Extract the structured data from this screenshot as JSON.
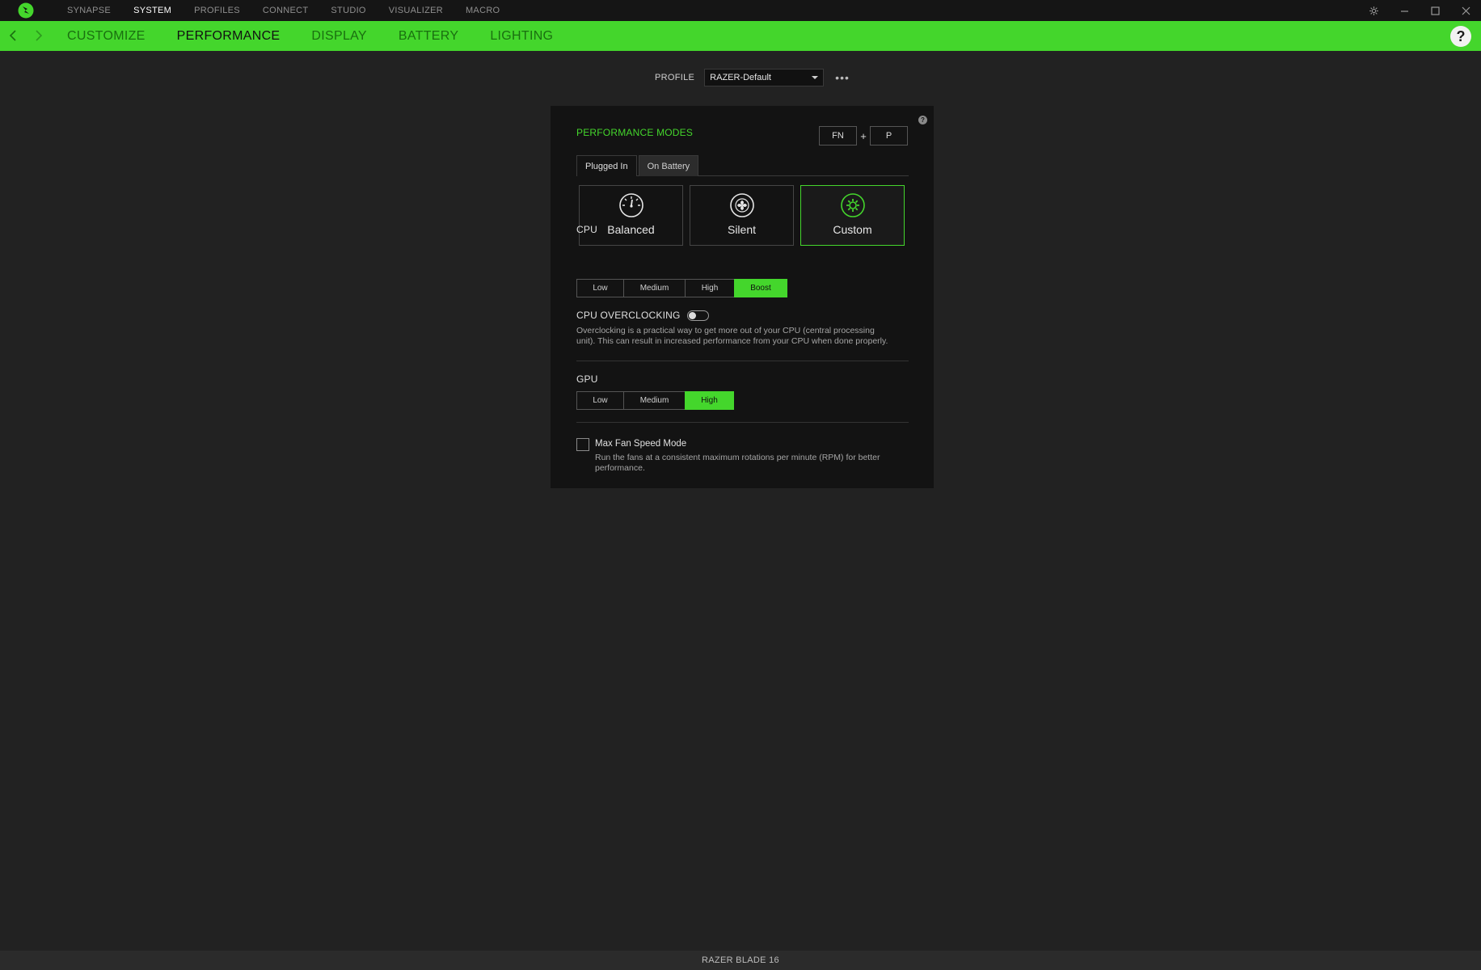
{
  "top_nav": {
    "items": [
      {
        "label": "SYNAPSE",
        "active": false
      },
      {
        "label": "SYSTEM",
        "active": true
      },
      {
        "label": "PROFILES",
        "active": false
      },
      {
        "label": "CONNECT",
        "active": false
      },
      {
        "label": "STUDIO",
        "active": false
      },
      {
        "label": "VISUALIZER",
        "active": false
      },
      {
        "label": "MACRO",
        "active": false
      }
    ]
  },
  "sub_nav": {
    "tabs": [
      {
        "label": "CUSTOMIZE",
        "active": false
      },
      {
        "label": "PERFORMANCE",
        "active": true
      },
      {
        "label": "DISPLAY",
        "active": false
      },
      {
        "label": "BATTERY",
        "active": false
      },
      {
        "label": "LIGHTING",
        "active": false
      }
    ],
    "help_icon": "?"
  },
  "profile": {
    "label": "PROFILE",
    "selected": "RAZER-Default",
    "more": "•••"
  },
  "panel": {
    "help_icon": "?",
    "title": "PERFORMANCE MODES",
    "shortcut": {
      "key1": "FN",
      "plus": "+",
      "key2": "P"
    },
    "power_tabs": [
      {
        "label": "Plugged In",
        "active": true
      },
      {
        "label": "On Battery",
        "active": false
      }
    ],
    "modes": [
      {
        "label": "Balanced",
        "icon": "gauge-icon",
        "selected": false
      },
      {
        "label": "Silent",
        "icon": "fan-icon",
        "selected": false
      },
      {
        "label": "Custom",
        "icon": "gear-icon",
        "selected": true
      }
    ],
    "cpu": {
      "label": "CPU",
      "options": [
        "Low",
        "Medium",
        "High",
        "Boost"
      ],
      "selected": "Boost"
    },
    "overclocking": {
      "label": "CPU OVERCLOCKING",
      "enabled": false,
      "desc_line1": "Overclocking is a practical way to get more out of your CPU (central processing",
      "desc_line2": "unit). This can result in increased performance from your CPU when done properly."
    },
    "gpu": {
      "label": "GPU",
      "options": [
        "Low",
        "Medium",
        "High"
      ],
      "selected": "High"
    },
    "fan": {
      "label": "Max Fan Speed Mode",
      "checked": false,
      "desc_line1": "Run the fans at a consistent maximum rotations per minute (RPM) for better",
      "desc_line2": "performance."
    }
  },
  "footer": {
    "device": "RAZER BLADE 16"
  },
  "colors": {
    "accent": "#44d62c",
    "background": "#222222",
    "panel": "#131313",
    "titlebar": "#151515"
  }
}
